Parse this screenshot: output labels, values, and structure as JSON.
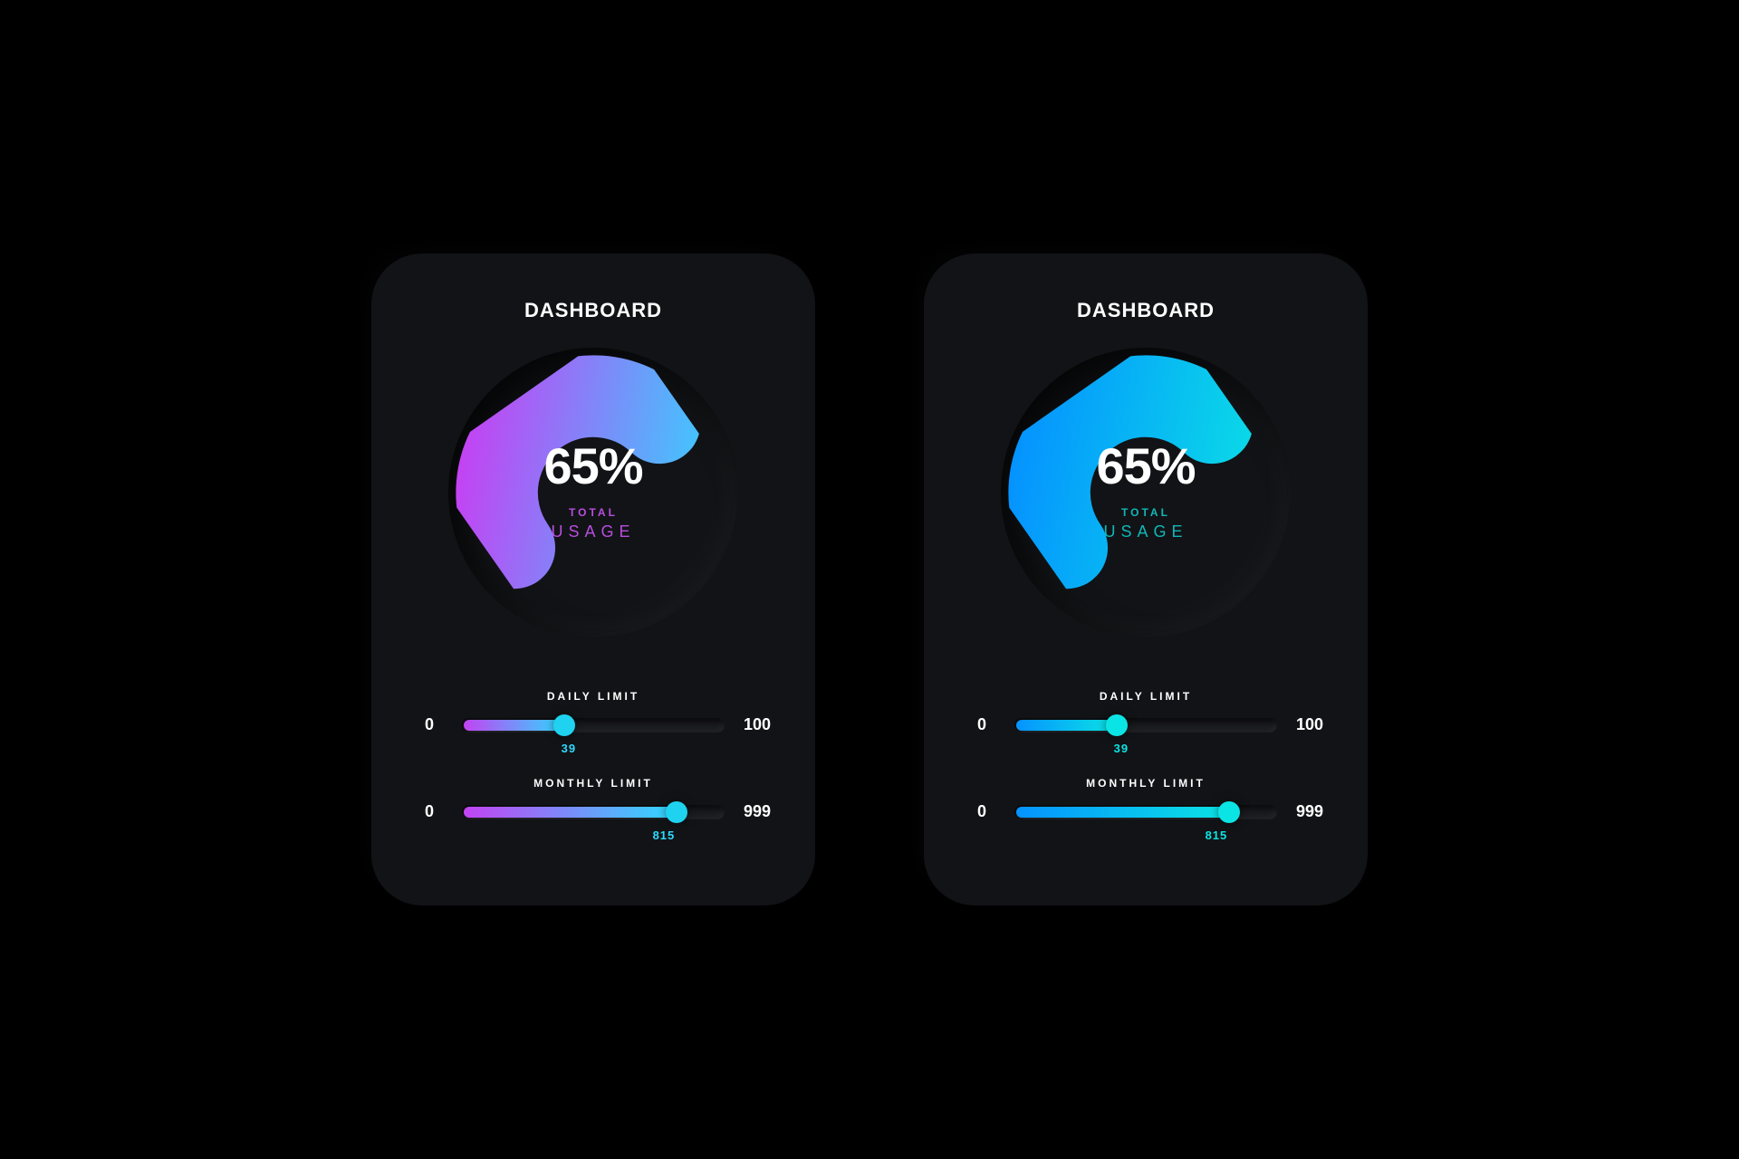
{
  "cards": [
    {
      "title": "DASHBOARD",
      "gauge": {
        "percent": 65,
        "percent_label": "65%",
        "sub1": "TOTAL",
        "sub2": "USAGE",
        "grad_from": "#2fd9ff",
        "grad_to": "#c343f3",
        "accent": "#b84de0"
      },
      "sliders": [
        {
          "label": "DAILY LIMIT",
          "min": 0,
          "min_label": "0",
          "max": 100,
          "max_label": "100",
          "value": 39,
          "value_label": "39",
          "fill_from": "#c343f3",
          "fill_to": "#2fd9ff",
          "thumb": "#1ed2f0",
          "value_color": "#2fd9ff"
        },
        {
          "label": "MONTHLY LIMIT",
          "min": 0,
          "min_label": "0",
          "max": 999,
          "max_label": "999",
          "value": 815,
          "value_label": "815",
          "fill_from": "#c343f3",
          "fill_to": "#2fd9ff",
          "thumb": "#1ed2f0",
          "value_color": "#2fd9ff"
        }
      ]
    },
    {
      "title": "DASHBOARD",
      "gauge": {
        "percent": 65,
        "percent_label": "65%",
        "sub1": "TOTAL",
        "sub2": "USAGE",
        "grad_from": "#0be4e4",
        "grad_to": "#0593ff",
        "accent": "#0fb7b7"
      },
      "sliders": [
        {
          "label": "DAILY LIMIT",
          "min": 0,
          "min_label": "0",
          "max": 100,
          "max_label": "100",
          "value": 39,
          "value_label": "39",
          "fill_from": "#0593ff",
          "fill_to": "#0be4e4",
          "thumb": "#0be4e4",
          "value_color": "#0be4e4"
        },
        {
          "label": "MONTHLY LIMIT",
          "min": 0,
          "min_label": "0",
          "max": 999,
          "max_label": "999",
          "value": 815,
          "value_label": "815",
          "fill_from": "#0593ff",
          "fill_to": "#0be4e4",
          "thumb": "#0be4e4",
          "value_color": "#0be4e4"
        }
      ]
    }
  ],
  "chart_data": [
    {
      "type": "gauge",
      "title": "DASHBOARD",
      "value": 65,
      "min": 0,
      "max": 100,
      "label": "TOTAL USAGE",
      "series": [
        {
          "name": "DAILY LIMIT",
          "value": 39,
          "min": 0,
          "max": 100
        },
        {
          "name": "MONTHLY LIMIT",
          "value": 815,
          "min": 0,
          "max": 999
        }
      ]
    },
    {
      "type": "gauge",
      "title": "DASHBOARD",
      "value": 65,
      "min": 0,
      "max": 100,
      "label": "TOTAL USAGE",
      "series": [
        {
          "name": "DAILY LIMIT",
          "value": 39,
          "min": 0,
          "max": 100
        },
        {
          "name": "MONTHLY LIMIT",
          "value": 815,
          "min": 0,
          "max": 999
        }
      ]
    }
  ]
}
